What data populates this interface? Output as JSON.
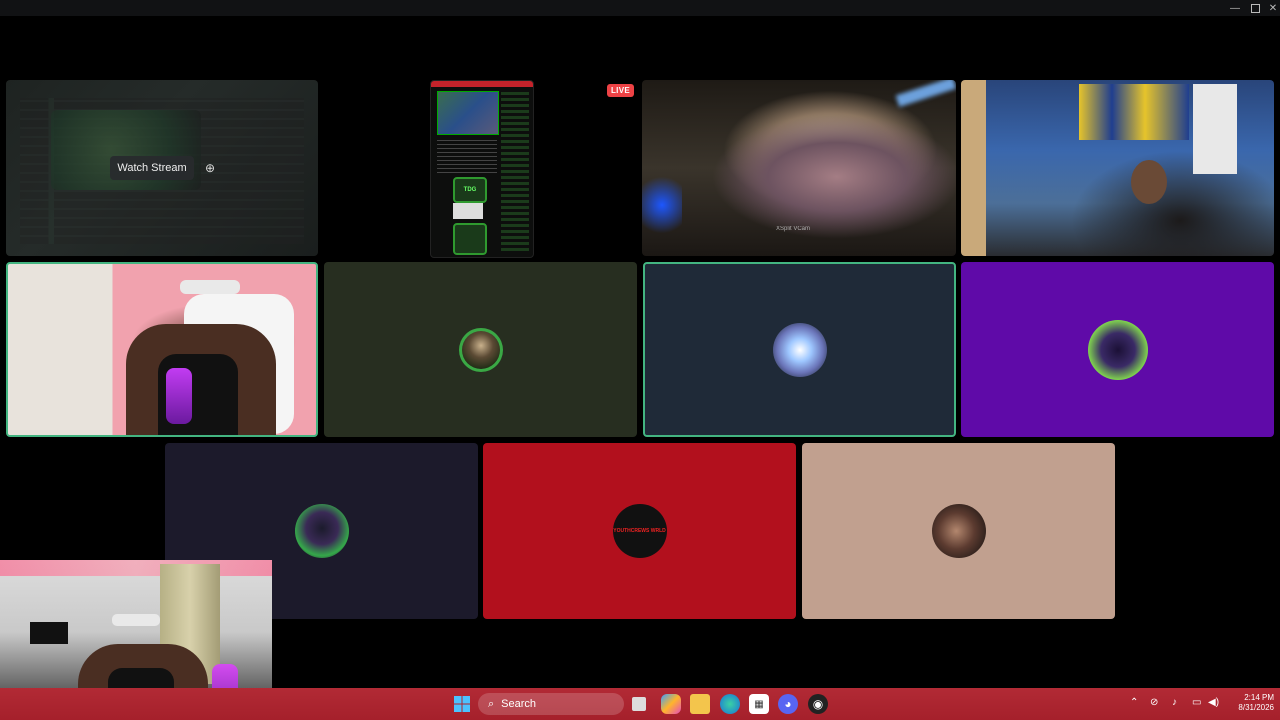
{
  "stream_tile": {
    "watch_label": "Watch Stream",
    "watch_icon": "add-screen-icon"
  },
  "live_badge": "LIVE",
  "phone_stream": {
    "badge_text": "TDG"
  },
  "cam_blonde": {
    "watermark": "XSplit VCam"
  },
  "avatars": {
    "green": {
      "label": "avatar-green-frame"
    },
    "red": {
      "text": "YOUTHCREWS WRLD"
    }
  },
  "taskbar": {
    "search_label": "Search",
    "clock_time": "2:14 PM",
    "clock_date": "8/31/2026",
    "accent": "#a5202b"
  },
  "colors": {
    "tile_olive": "#272e20",
    "tile_navy": "#1f2a38",
    "tile_purple": "#5f0aa8",
    "tile_dark": "#1c1a2b",
    "tile_red": "#b2101d",
    "tile_beige": "#c1a08f",
    "speaking_ring": "#43b581"
  }
}
